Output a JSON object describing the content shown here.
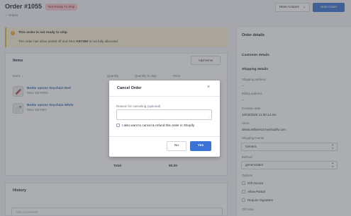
{
  "header": {
    "title": "Order #1055",
    "status_badge": "Not Ready To Ship",
    "back_label": "Orders",
    "more_actions_label": "More Actions",
    "hold_order_label": "Hold Order"
  },
  "warning": {
    "title": "This order is not ready to ship",
    "text_prefix": "The order has allow partial off and SKU ",
    "sku": "KEYWH",
    "text_suffix": " is not fully allocated"
  },
  "items": {
    "title": "Items",
    "add_items_label": "Add Items",
    "columns": [
      "Items",
      "Quantity",
      "Quantity to ship",
      "Price"
    ],
    "rows": [
      {
        "name": "Bottle opener keychain Red",
        "sku": "SKU: KEYRED"
      },
      {
        "name": "Bottle opener keychain White",
        "sku": "SKU: KEYWH"
      }
    ],
    "total_label": "Total",
    "total_value": "$0.00"
  },
  "history": {
    "title": "History",
    "comment_placeholder": "Add a comment"
  },
  "order_details": {
    "title": "Order details",
    "customer_details_label": "Customer details",
    "shipping_details_label": "Shipping details",
    "shipping_address_label": "Shipping address",
    "shipping_address_value": "--",
    "billing_address_label": "Billing address",
    "billing_address_value": "--",
    "creation_date_label": "Creation date",
    "creation_date_value": "10/03/2025 11:00:14 am",
    "store_label": "Store",
    "store_value": "alissa.williams3.myshopify.com",
    "shipping_carrier_label": "Shipping Carrier",
    "shipping_carrier_value": "Generic",
    "method_label": "Method",
    "method_value": "genericlabel",
    "options_label": "Options",
    "options": [
      "Gift Invoice",
      "Allow Partial",
      "Require Signature"
    ],
    "gift_note_label": "Gift note"
  },
  "modal": {
    "title": "Cancel Order",
    "reason_label": "Reason for canceling (optional)",
    "refund_label": "I also want to cancel & refund this order in Shopify",
    "no_label": "No",
    "yes_label": "Yes"
  },
  "colors": {
    "primary": "#3b74d6",
    "badge_bg": "#f6c8cc",
    "badge_text": "#9b2230",
    "warning_bg": "#faf1d6"
  }
}
